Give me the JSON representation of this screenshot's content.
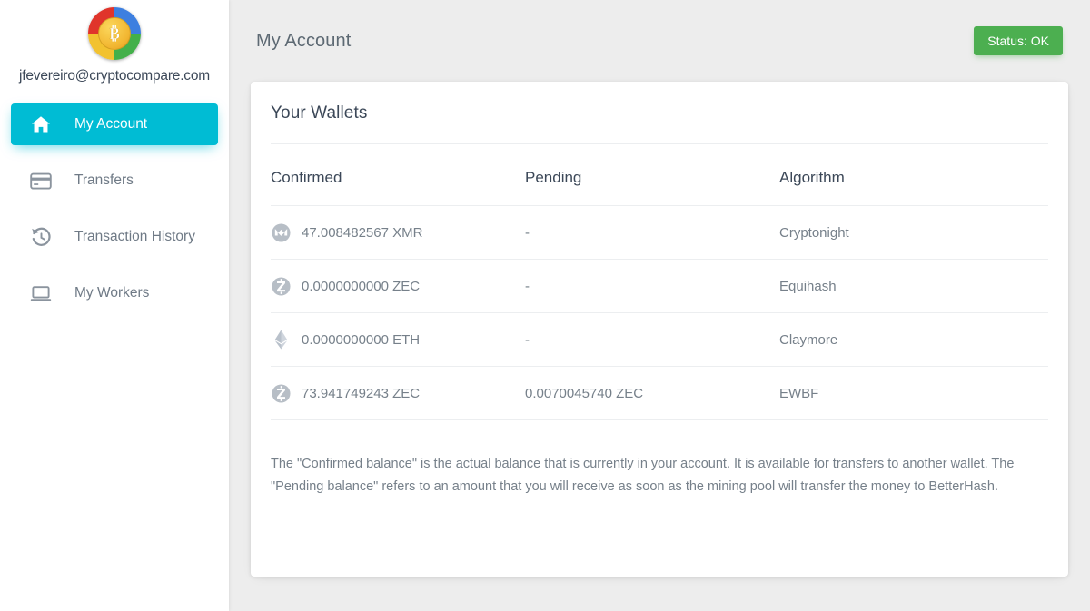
{
  "sidebar": {
    "logo_icon": "bitcoin-multicolor-logo",
    "account_email": "jfevereiro@cryptocompare.com",
    "items": [
      {
        "label": "My Account",
        "icon": "home-icon",
        "active": true
      },
      {
        "label": "Transfers",
        "icon": "credit-card-icon",
        "active": false
      },
      {
        "label": "Transaction History",
        "icon": "history-icon",
        "active": false
      },
      {
        "label": "My Workers",
        "icon": "laptop-icon",
        "active": false
      }
    ]
  },
  "header": {
    "title": "My Account",
    "status_label": "Status: OK",
    "status_color": "#4caf50"
  },
  "card": {
    "title": "Your Wallets",
    "columns": [
      "Confirmed",
      "Pending",
      "Algorithm"
    ],
    "rows": [
      {
        "coin_icon": "monero-icon",
        "confirmed": "47.008482567 XMR",
        "pending": "-",
        "algorithm": "Cryptonight"
      },
      {
        "coin_icon": "zcash-icon",
        "confirmed": "0.0000000000 ZEC",
        "pending": "-",
        "algorithm": "Equihash"
      },
      {
        "coin_icon": "ethereum-icon",
        "confirmed": "0.0000000000 ETH",
        "pending": "-",
        "algorithm": "Claymore"
      },
      {
        "coin_icon": "zcash-icon",
        "confirmed": "73.941749243 ZEC",
        "pending": "0.0070045740 ZEC",
        "algorithm": "EWBF"
      }
    ],
    "note": "The \"Confirmed balance\" is the actual balance that is currently in your account. It is available for transfers to another wallet. The \"Pending balance\" refers to an amount that you will receive as soon as the mining pool will transfer the money to BetterHash."
  },
  "theme": {
    "accent": "#00bcd4",
    "page_bg": "#ededed",
    "card_bg": "#ffffff",
    "text_dark": "#3c4858",
    "text_muted": "#76808a"
  }
}
